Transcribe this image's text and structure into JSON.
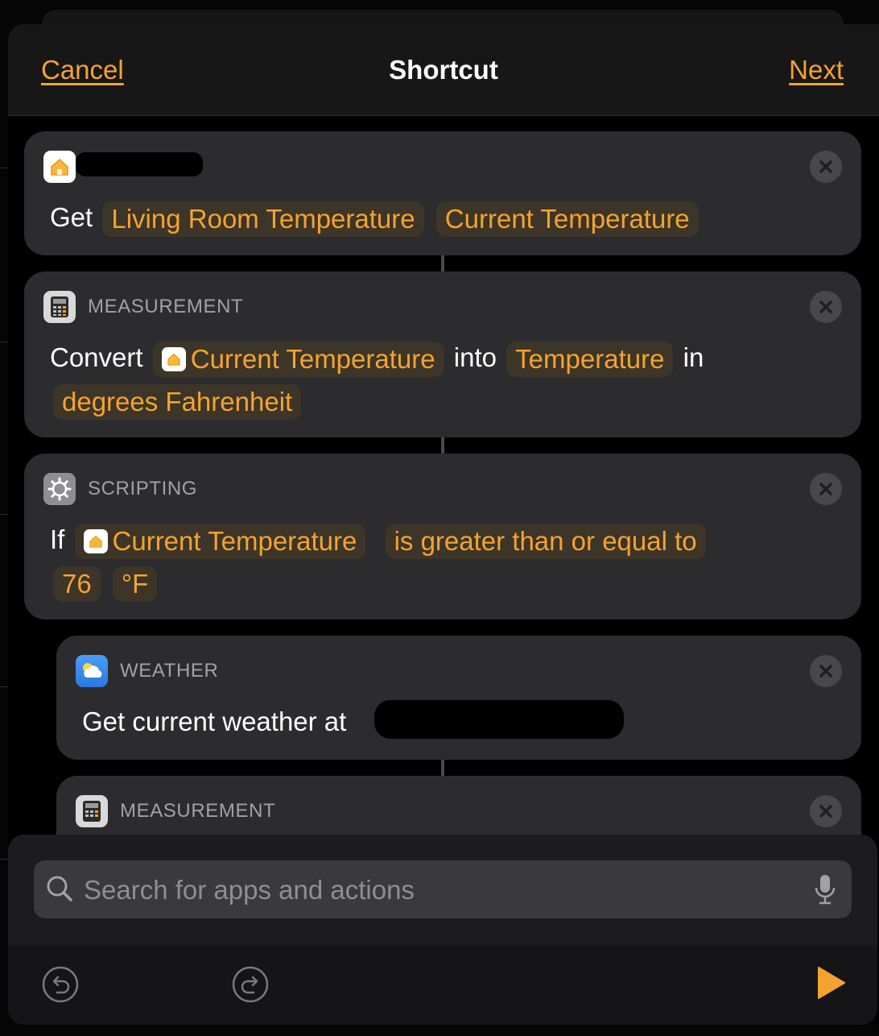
{
  "nav": {
    "cancel_label": "Cancel",
    "title": "Shortcut",
    "next_label": "Next"
  },
  "actions": [
    {
      "app": "Home",
      "icon": "home-icon",
      "verb": "Get",
      "params": [
        "Living Room Temperature",
        "Current Temperature"
      ]
    },
    {
      "category": "MEASUREMENT",
      "icon": "calculator-icon",
      "verb": "Convert",
      "variable": "Current Temperature",
      "into": "into",
      "unit_type": "Temperature",
      "in": "in",
      "unit": "degrees Fahrenheit"
    },
    {
      "category": "SCRIPTING",
      "icon": "gear-icon",
      "verb": "If",
      "variable": "Current Temperature",
      "condition": "is greater than or equal to",
      "value": "76",
      "unit": "°F"
    },
    {
      "category": "WEATHER",
      "icon": "weather-icon",
      "text": "Get current weather at"
    },
    {
      "category": "MEASUREMENT",
      "icon": "calculator-icon"
    }
  ],
  "search": {
    "placeholder": "Search for apps and actions",
    "value": ""
  },
  "colors": {
    "accent": "#f4a32e",
    "card": "#2c2c2e",
    "background": "#000000"
  }
}
